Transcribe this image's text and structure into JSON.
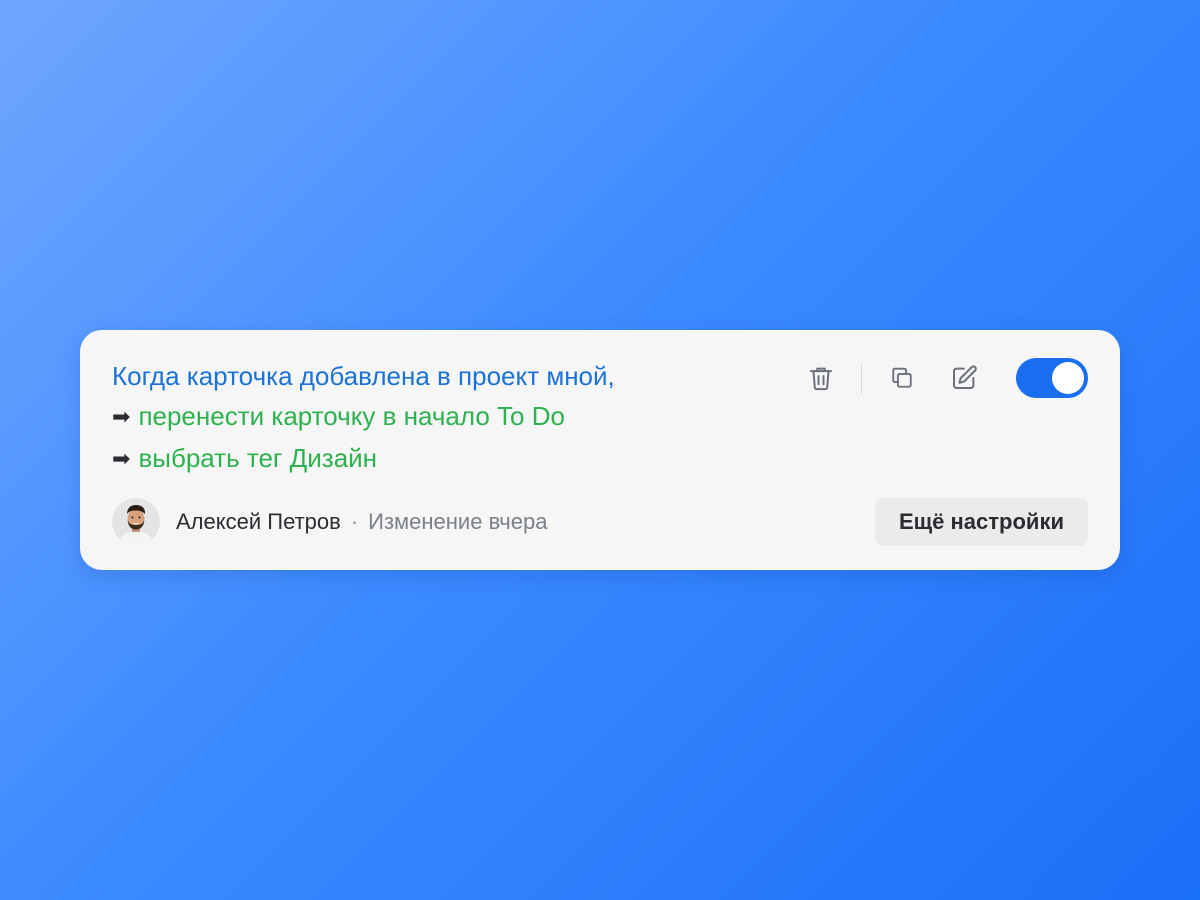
{
  "rule": {
    "trigger": "Когда карточка добавлена в проект мной,",
    "actions": [
      {
        "arrow": "➡",
        "text": "перенести карточку в начало To Do"
      },
      {
        "arrow": "➡",
        "text": "выбрать тег Дизайн"
      }
    ]
  },
  "toolbar": {
    "delete_icon": "trash-icon",
    "copy_icon": "copy-icon",
    "edit_icon": "pencil-icon",
    "toggle_on": true
  },
  "footer": {
    "author": "Алексей Петров",
    "separator": "·",
    "modified": "Изменение вчера",
    "more_settings_label": "Ещё настройки"
  },
  "colors": {
    "trigger_text": "#1b72d9",
    "action_text": "#2eb24f",
    "toggle_on": "#1a6ff0",
    "background_gradient": [
      "#6fa6ff",
      "#1a6ff7"
    ]
  }
}
